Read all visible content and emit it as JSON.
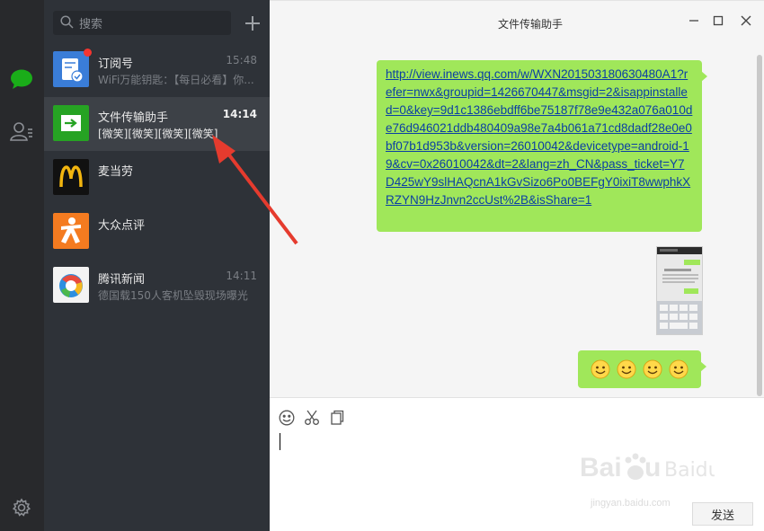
{
  "rail": {
    "chat_icon": "chat-bubble-icon",
    "contacts_icon": "contacts-icon",
    "settings_icon": "gear-icon",
    "active_color": "#1aad19"
  },
  "search": {
    "placeholder": "搜索",
    "add_icon": "plus-icon"
  },
  "chats": [
    {
      "name": "订阅号",
      "time": "15:48",
      "preview": "WiFi万能钥匙：【每日必看】你...",
      "avatar": "subscription-icon",
      "unread": true
    },
    {
      "name": "文件传输助手",
      "time": "14:14",
      "preview": "[微笑][微笑][微笑][微笑]",
      "avatar": "file-transfer-icon",
      "active": true
    },
    {
      "name": "麦当劳",
      "time": "",
      "preview": "",
      "avatar": "mcdonalds-logo"
    },
    {
      "name": "大众点评",
      "time": "",
      "preview": "",
      "avatar": "dianping-logo"
    },
    {
      "name": "腾讯新闻",
      "time": "14:11",
      "preview": "德国载150人客机坠毁现场曝光",
      "avatar": "tencent-news-logo"
    }
  ],
  "conversation": {
    "title": "文件传输助手",
    "link_message": "http://view.inews.qq.com/w/WXN201503180630480A1?refer=nwx&groupid=1426670447&msgid=2&isappinstalled=0&key=9d1c1386ebdff6be75187f78e9e432a076a010de76d946021ddb480409a98e7a4b061a71cd8dadf28e0e0bf07b1d953b&version=26010042&devicetype=android-19&cv=0x26010042&dt=2&lang=zh_CN&pass_ticket=Y7D425wY9slHAQcnA1kGvSizo6Po0BEFgY0ixiT8wwphkXRZYN9HzJnvn2ccUst%2B&isShare=1",
    "image_message": "phone-screenshot-thumbnail",
    "emoji_message": [
      "smiley",
      "smiley",
      "smiley",
      "smiley"
    ]
  },
  "window_controls": {
    "minimize": "minimize-icon",
    "maximize": "maximize-icon",
    "close": "close-icon"
  },
  "input": {
    "emoji_icon": "emoji-icon",
    "screenshot_icon": "scissors-icon",
    "file_icon": "file-icon",
    "value": "",
    "send_label": "发送"
  },
  "watermark": {
    "brand": "Baidu 经验",
    "url": "jingyan.baidu.com"
  },
  "accent": {
    "bubble": "#a0e75a",
    "annotation_arrow": "#e53b2e"
  }
}
